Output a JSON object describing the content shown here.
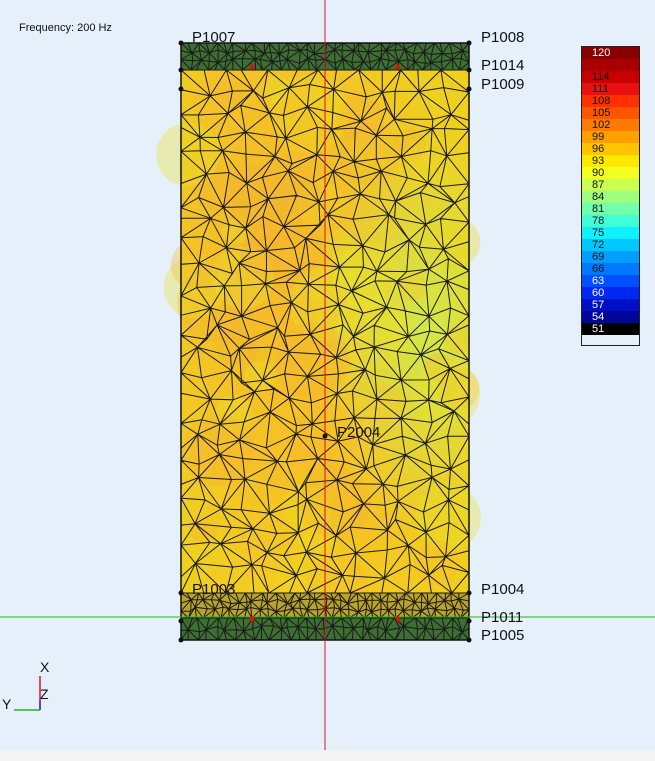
{
  "frequency_label": "Frequency: 200 Hz",
  "points": {
    "p1007": "P1007",
    "p1008": "P1008",
    "p1014": "P1014",
    "p1009": "P1009",
    "p2004": "P2004",
    "p1004": "P1004",
    "p1003": "P1003",
    "p1011": "P1011",
    "p1005": "P1005"
  },
  "axes": {
    "x": "X",
    "y": "Y",
    "z": "Z"
  },
  "legend": {
    "entries": [
      {
        "label": "120",
        "color": "#8a0000"
      },
      {
        "label": "",
        "color": "#a80000"
      },
      {
        "label": "114",
        "color": "#c80000"
      },
      {
        "label": "111",
        "color": "#e81010"
      },
      {
        "label": "108",
        "color": "#ff3000"
      },
      {
        "label": "105",
        "color": "#ff5500"
      },
      {
        "label": "102",
        "color": "#ff7a00"
      },
      {
        "label": "99",
        "color": "#ffa000"
      },
      {
        "label": "96",
        "color": "#ffc400"
      },
      {
        "label": "93",
        "color": "#ffe800"
      },
      {
        "label": "90",
        "color": "#f2ff20"
      },
      {
        "label": "87",
        "color": "#c8ff50"
      },
      {
        "label": "84",
        "color": "#9dff7d"
      },
      {
        "label": "81",
        "color": "#70ffaa"
      },
      {
        "label": "78",
        "color": "#40ffd5"
      },
      {
        "label": "75",
        "color": "#10f0ff"
      },
      {
        "label": "72",
        "color": "#00c8ff"
      },
      {
        "label": "69",
        "color": "#009fff"
      },
      {
        "label": "66",
        "color": "#0078ff"
      },
      {
        "label": "63",
        "color": "#0050ff"
      },
      {
        "label": "60",
        "color": "#0028f0"
      },
      {
        "label": "57",
        "color": "#0010c8"
      },
      {
        "label": "54",
        "color": "#00069a"
      },
      {
        "label": "51",
        "color": "#000000"
      }
    ]
  },
  "colors": {
    "hot": "#f5b830",
    "mid": "#f2d21a",
    "cool": "#d6e640",
    "band": "#3d6e32",
    "band_light": "#6f8f3c",
    "mesh": "#1a1a1a",
    "axis_red": "#e0102a",
    "axis_green": "#1db81d",
    "axis_blue": "#1a3fd6",
    "marker_red": "#e01010"
  }
}
